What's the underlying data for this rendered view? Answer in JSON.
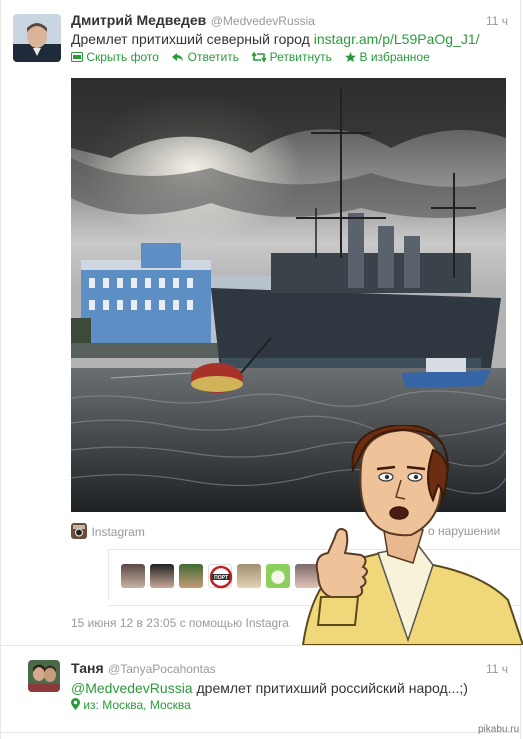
{
  "tweet1": {
    "name": "Дмитрий Медведев",
    "handle": "@MedvedevRussia",
    "time": "11 ч",
    "text": "Дремлет притихший северный город",
    "link": "instagr.am/p/L59PaOg_J1/",
    "actions": {
      "hide_photo": "Скрыть фото",
      "reply": "Ответить",
      "retweet": "Ретвитнуть",
      "favorite": "В избранное"
    },
    "photo_source": "Instagram",
    "report": "о нарушении",
    "footer": "15 июня 12 в 23:05 с помощью Instagra"
  },
  "tweet2": {
    "name": "Таня",
    "handle": "@TanyaPocahontas",
    "time": "11 ч",
    "mention": "@MedvedevRussia",
    "text": "дремлет притихший российский народ...;)",
    "location": "из: Москва, Москва"
  },
  "watermark": "pikabu.ru",
  "thumb_badge": "ПОРТ",
  "colors": {
    "link": "#2a9b3a",
    "muted": "#999999",
    "text": "#333333"
  },
  "icons": [
    "photo-icon",
    "reply-icon",
    "retweet-icon",
    "star-icon",
    "instagram-icon",
    "location-pin-icon"
  ]
}
